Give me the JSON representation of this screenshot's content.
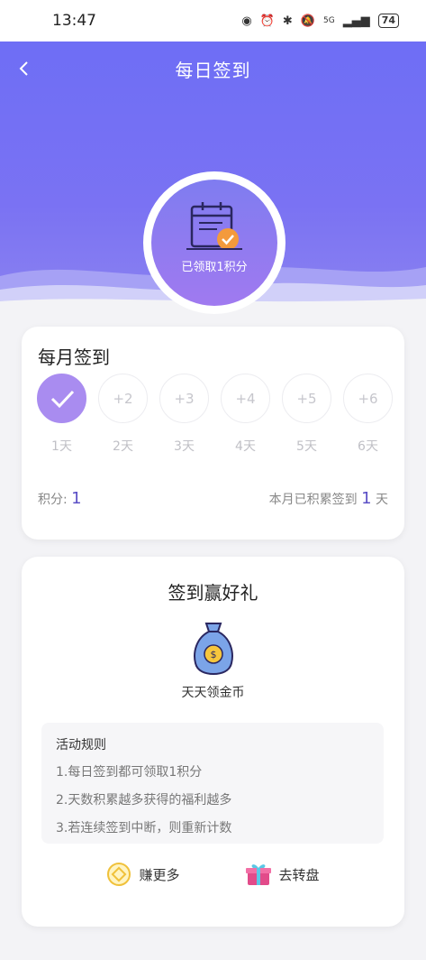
{
  "status_bar": {
    "time": "13:47",
    "network": "5G",
    "battery": "74"
  },
  "header": {
    "title": "每日签到",
    "badge_text": "已领取1积分"
  },
  "monthly": {
    "title": "每月签到",
    "days": [
      {
        "bonus": "",
        "label": "1天",
        "checked": true
      },
      {
        "bonus": "+2",
        "label": "2天",
        "checked": false
      },
      {
        "bonus": "+3",
        "label": "3天",
        "checked": false
      },
      {
        "bonus": "+4",
        "label": "4天",
        "checked": false
      },
      {
        "bonus": "+5",
        "label": "5天",
        "checked": false
      },
      {
        "bonus": "+6",
        "label": "6天",
        "checked": false
      }
    ],
    "points_label": "积分:",
    "points_value": "1",
    "accum_label": "本月已积累签到",
    "accum_value": "1",
    "accum_unit": "天"
  },
  "reward": {
    "title": "签到赢好礼",
    "coin_label": "天天领金币",
    "rules_title": "活动规则",
    "rules": [
      "1.每日签到都可领取1积分",
      "2.天数积累越多获得的福利越多",
      "3.若连续签到中断，则重新计数"
    ],
    "earn_more": "赚更多",
    "wheel": "去转盘"
  },
  "colors": {
    "accent": "#6e6ef5",
    "check": "#a98cf0",
    "number": "#5b4fc6"
  }
}
